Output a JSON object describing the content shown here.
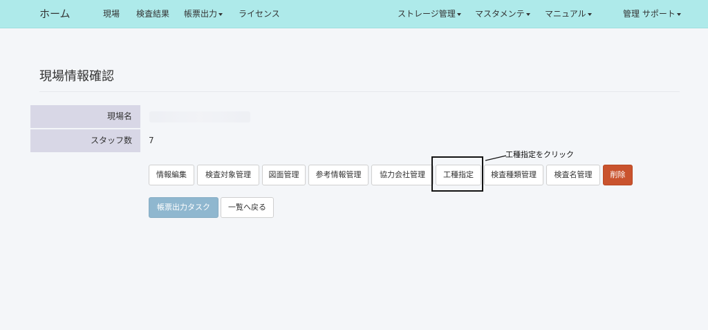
{
  "navbar": {
    "brand": "ホーム",
    "left_items": [
      "現場",
      "検査結果",
      "帳票出力",
      "ライセンス"
    ],
    "right_items": [
      "ストレージ管理",
      "マスタメンテ",
      "マニュアル",
      "管理 サポート"
    ]
  },
  "page": {
    "title": "現場情報確認"
  },
  "info": {
    "site_name_label": "現場名",
    "site_name_value": "",
    "staff_count_label": "スタッフ数",
    "staff_count_value": "7"
  },
  "actions": {
    "edit_info": "情報編集",
    "inspection_targets": "検査対象管理",
    "drawings": "図面管理",
    "reference_info": "参考情報管理",
    "partner_companies": "協力会社管理",
    "work_type": "工種指定",
    "inspection_types": "検査種類管理",
    "inspection_names": "検査名管理",
    "delete": "削除",
    "report_task": "帳票出力タスク",
    "back_to_list": "一覧へ戻る"
  },
  "annotation": {
    "text": "工種指定をクリック"
  },
  "colors": {
    "navbar_bg": "#aeeaea",
    "page_bg": "#f4f6f9",
    "label_bg": "#d8d7e6",
    "danger": "#c9532e",
    "muted_primary": "#8fb7cf"
  }
}
